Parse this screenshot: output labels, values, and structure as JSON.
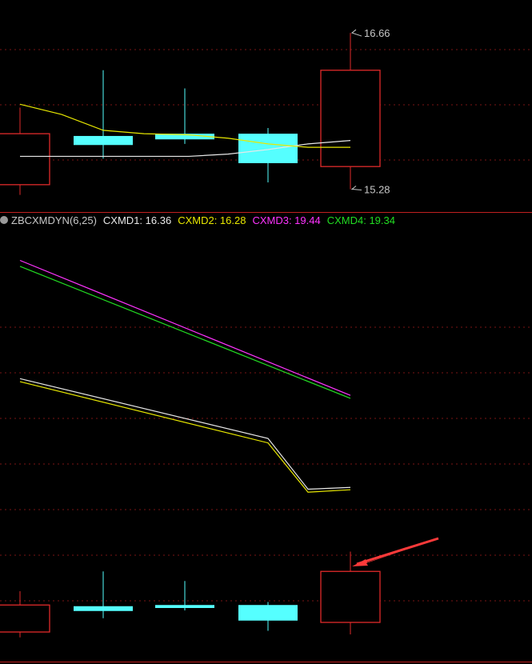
{
  "colors": {
    "background": "#000000",
    "grid": "#7a1414",
    "divider": "#c02020",
    "up": "#e02a2a",
    "down": "#55ffff",
    "white_line": "#e8e8e8",
    "yellow_line": "#e8e800",
    "magenta_line": "#ff33ff",
    "green_line": "#22dd22",
    "label_gray": "#c8c8c8",
    "arrow": "#ff3a3a"
  },
  "indicator": {
    "name": "ZBCXMDYN(6,25)",
    "cxmd1": "CXMD1: 16.36",
    "cxmd2": "CXMD2: 16.28",
    "cxmd3": "CXMD3: 19.44",
    "cxmd4": "CXMD4: 19.34"
  },
  "chart_data": [
    {
      "type": "candlestick",
      "panel": "price",
      "candles": [
        {
          "open": 15.32,
          "close": 15.77,
          "high": 16.0,
          "low": 15.23,
          "dir": "up"
        },
        {
          "open": 15.75,
          "close": 15.67,
          "high": 16.33,
          "low": 15.55,
          "dir": "down"
        },
        {
          "open": 15.77,
          "close": 15.72,
          "high": 16.17,
          "low": 15.68,
          "dir": "down"
        },
        {
          "open": 15.77,
          "close": 15.51,
          "high": 15.82,
          "low": 15.34,
          "dir": "down"
        },
        {
          "open": 15.48,
          "close": 16.33,
          "high": 16.66,
          "low": 15.28,
          "dir": "up"
        }
      ],
      "ma_white": [
        15.57,
        15.57,
        15.57,
        15.57,
        15.57,
        15.59,
        15.63,
        15.68,
        15.71,
        15.76
      ],
      "ma_yellow": [
        16.03,
        15.94,
        15.8,
        15.77,
        15.76,
        15.73,
        15.68,
        15.65,
        15.65,
        15.65
      ],
      "annotations": {
        "high_label": "16.66",
        "low_label": "15.28"
      },
      "ylim": [
        15.1,
        16.95
      ]
    },
    {
      "type": "line",
      "panel": "indicator",
      "series": [
        {
          "name": "CXMD3",
          "values": [
            23.96,
            19.44
          ]
        },
        {
          "name": "CXMD4",
          "values": [
            23.76,
            19.34
          ]
        }
      ],
      "ylim": [
        10.5,
        25.5
      ]
    },
    {
      "type": "line",
      "panel": "indicator",
      "series": [
        {
          "name": "CXMD1",
          "values": [
            20.0,
            18.0,
            16.3,
            16.36
          ]
        },
        {
          "name": "CXMD2",
          "values": [
            19.9,
            17.85,
            16.2,
            16.28
          ]
        }
      ],
      "ylim": [
        10.5,
        25.5
      ]
    }
  ]
}
